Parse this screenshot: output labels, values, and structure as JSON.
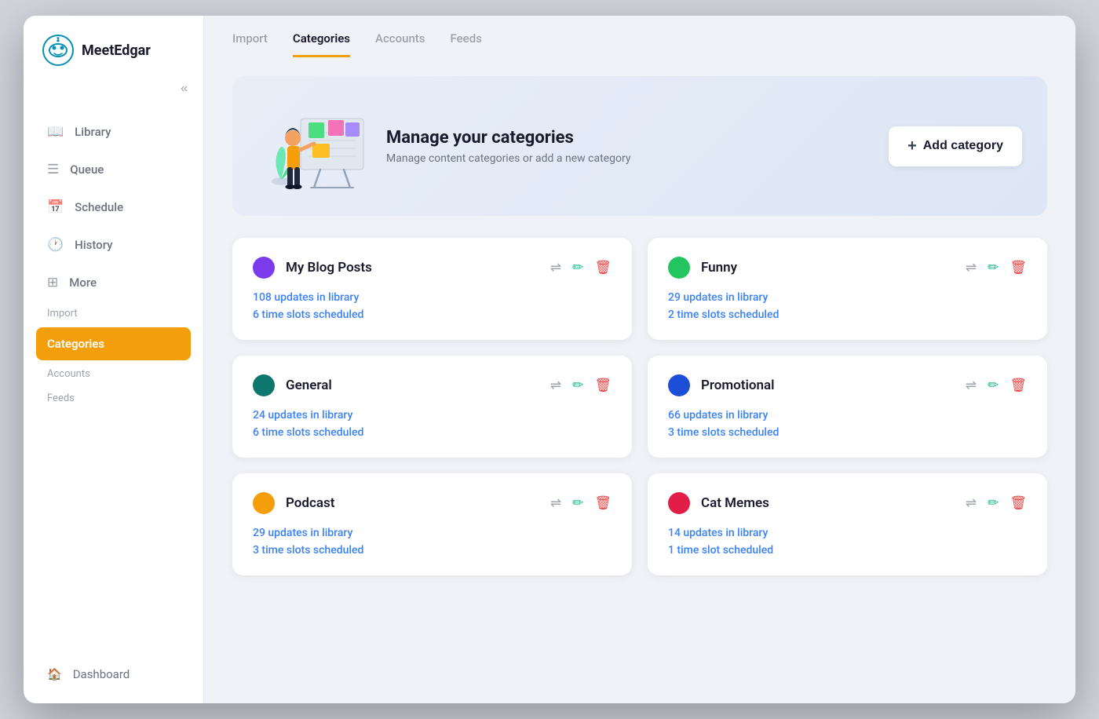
{
  "app": {
    "name": "MeetEdgar"
  },
  "sidebar": {
    "collapse_label": "«",
    "nav_items": [
      {
        "id": "library",
        "label": "Library",
        "icon": "📖"
      },
      {
        "id": "queue",
        "label": "Queue",
        "icon": "☰"
      },
      {
        "id": "schedule",
        "label": "Schedule",
        "icon": "📅"
      },
      {
        "id": "history",
        "label": "History",
        "icon": "🕐"
      },
      {
        "id": "more",
        "label": "More",
        "icon": "⊞"
      }
    ],
    "more_items": [
      {
        "id": "import",
        "label": "Import"
      },
      {
        "id": "categories",
        "label": "Categories",
        "active": true
      },
      {
        "id": "accounts",
        "label": "Accounts"
      },
      {
        "id": "feeds",
        "label": "Feeds"
      }
    ],
    "dashboard_label": "Dashboard",
    "dashboard_icon": "🏠"
  },
  "tabs": [
    {
      "id": "import",
      "label": "Import"
    },
    {
      "id": "categories",
      "label": "Categories",
      "active": true
    },
    {
      "id": "accounts",
      "label": "Accounts"
    },
    {
      "id": "feeds",
      "label": "Feeds"
    }
  ],
  "hero": {
    "title": "Manage your categories",
    "subtitle": "Manage content categories or add a new category",
    "add_button_label": "Add category"
  },
  "categories": [
    {
      "id": "my-blog-posts",
      "name": "My Blog Posts",
      "color": "#7c3aed",
      "updates": "108 updates in library",
      "slots": "6 time slots scheduled"
    },
    {
      "id": "funny",
      "name": "Funny",
      "color": "#22c55e",
      "updates": "29 updates in library",
      "slots": "2 time slots scheduled"
    },
    {
      "id": "general",
      "name": "General",
      "color": "#0f766e",
      "updates": "24 updates in library",
      "slots": "6 time slots scheduled"
    },
    {
      "id": "promotional",
      "name": "Promotional",
      "color": "#1d4ed8",
      "updates": "66 updates in library",
      "slots": "3 time slots scheduled"
    },
    {
      "id": "podcast",
      "name": "Podcast",
      "color": "#f59e0b",
      "updates": "29 updates in library",
      "slots": "3 time slots scheduled"
    },
    {
      "id": "cat-memes",
      "name": "Cat Memes",
      "color": "#e11d48",
      "updates": "14 updates in library",
      "slots": "1 time slot scheduled"
    }
  ]
}
